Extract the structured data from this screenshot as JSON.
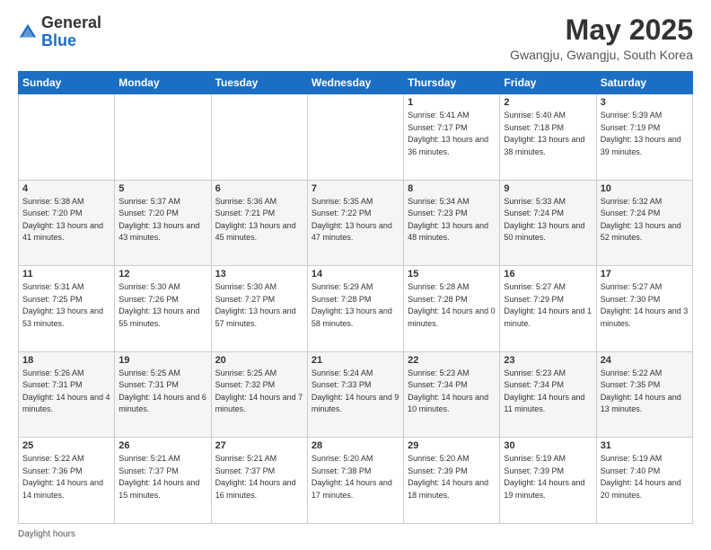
{
  "header": {
    "logo": {
      "general": "General",
      "blue": "Blue"
    },
    "title": "May 2025",
    "subtitle": "Gwangju, Gwangju, South Korea"
  },
  "calendar": {
    "days": [
      "Sunday",
      "Monday",
      "Tuesday",
      "Wednesday",
      "Thursday",
      "Friday",
      "Saturday"
    ],
    "weeks": [
      [
        {
          "day": "",
          "sunrise": "",
          "sunset": "",
          "daylight": ""
        },
        {
          "day": "",
          "sunrise": "",
          "sunset": "",
          "daylight": ""
        },
        {
          "day": "",
          "sunrise": "",
          "sunset": "",
          "daylight": ""
        },
        {
          "day": "",
          "sunrise": "",
          "sunset": "",
          "daylight": ""
        },
        {
          "day": "1",
          "sunrise": "Sunrise: 5:41 AM",
          "sunset": "Sunset: 7:17 PM",
          "daylight": "Daylight: 13 hours and 36 minutes."
        },
        {
          "day": "2",
          "sunrise": "Sunrise: 5:40 AM",
          "sunset": "Sunset: 7:18 PM",
          "daylight": "Daylight: 13 hours and 38 minutes."
        },
        {
          "day": "3",
          "sunrise": "Sunrise: 5:39 AM",
          "sunset": "Sunset: 7:19 PM",
          "daylight": "Daylight: 13 hours and 39 minutes."
        }
      ],
      [
        {
          "day": "4",
          "sunrise": "Sunrise: 5:38 AM",
          "sunset": "Sunset: 7:20 PM",
          "daylight": "Daylight: 13 hours and 41 minutes."
        },
        {
          "day": "5",
          "sunrise": "Sunrise: 5:37 AM",
          "sunset": "Sunset: 7:20 PM",
          "daylight": "Daylight: 13 hours and 43 minutes."
        },
        {
          "day": "6",
          "sunrise": "Sunrise: 5:36 AM",
          "sunset": "Sunset: 7:21 PM",
          "daylight": "Daylight: 13 hours and 45 minutes."
        },
        {
          "day": "7",
          "sunrise": "Sunrise: 5:35 AM",
          "sunset": "Sunset: 7:22 PM",
          "daylight": "Daylight: 13 hours and 47 minutes."
        },
        {
          "day": "8",
          "sunrise": "Sunrise: 5:34 AM",
          "sunset": "Sunset: 7:23 PM",
          "daylight": "Daylight: 13 hours and 48 minutes."
        },
        {
          "day": "9",
          "sunrise": "Sunrise: 5:33 AM",
          "sunset": "Sunset: 7:24 PM",
          "daylight": "Daylight: 13 hours and 50 minutes."
        },
        {
          "day": "10",
          "sunrise": "Sunrise: 5:32 AM",
          "sunset": "Sunset: 7:24 PM",
          "daylight": "Daylight: 13 hours and 52 minutes."
        }
      ],
      [
        {
          "day": "11",
          "sunrise": "Sunrise: 5:31 AM",
          "sunset": "Sunset: 7:25 PM",
          "daylight": "Daylight: 13 hours and 53 minutes."
        },
        {
          "day": "12",
          "sunrise": "Sunrise: 5:30 AM",
          "sunset": "Sunset: 7:26 PM",
          "daylight": "Daylight: 13 hours and 55 minutes."
        },
        {
          "day": "13",
          "sunrise": "Sunrise: 5:30 AM",
          "sunset": "Sunset: 7:27 PM",
          "daylight": "Daylight: 13 hours and 57 minutes."
        },
        {
          "day": "14",
          "sunrise": "Sunrise: 5:29 AM",
          "sunset": "Sunset: 7:28 PM",
          "daylight": "Daylight: 13 hours and 58 minutes."
        },
        {
          "day": "15",
          "sunrise": "Sunrise: 5:28 AM",
          "sunset": "Sunset: 7:28 PM",
          "daylight": "Daylight: 14 hours and 0 minutes."
        },
        {
          "day": "16",
          "sunrise": "Sunrise: 5:27 AM",
          "sunset": "Sunset: 7:29 PM",
          "daylight": "Daylight: 14 hours and 1 minute."
        },
        {
          "day": "17",
          "sunrise": "Sunrise: 5:27 AM",
          "sunset": "Sunset: 7:30 PM",
          "daylight": "Daylight: 14 hours and 3 minutes."
        }
      ],
      [
        {
          "day": "18",
          "sunrise": "Sunrise: 5:26 AM",
          "sunset": "Sunset: 7:31 PM",
          "daylight": "Daylight: 14 hours and 4 minutes."
        },
        {
          "day": "19",
          "sunrise": "Sunrise: 5:25 AM",
          "sunset": "Sunset: 7:31 PM",
          "daylight": "Daylight: 14 hours and 6 minutes."
        },
        {
          "day": "20",
          "sunrise": "Sunrise: 5:25 AM",
          "sunset": "Sunset: 7:32 PM",
          "daylight": "Daylight: 14 hours and 7 minutes."
        },
        {
          "day": "21",
          "sunrise": "Sunrise: 5:24 AM",
          "sunset": "Sunset: 7:33 PM",
          "daylight": "Daylight: 14 hours and 9 minutes."
        },
        {
          "day": "22",
          "sunrise": "Sunrise: 5:23 AM",
          "sunset": "Sunset: 7:34 PM",
          "daylight": "Daylight: 14 hours and 10 minutes."
        },
        {
          "day": "23",
          "sunrise": "Sunrise: 5:23 AM",
          "sunset": "Sunset: 7:34 PM",
          "daylight": "Daylight: 14 hours and 11 minutes."
        },
        {
          "day": "24",
          "sunrise": "Sunrise: 5:22 AM",
          "sunset": "Sunset: 7:35 PM",
          "daylight": "Daylight: 14 hours and 13 minutes."
        }
      ],
      [
        {
          "day": "25",
          "sunrise": "Sunrise: 5:22 AM",
          "sunset": "Sunset: 7:36 PM",
          "daylight": "Daylight: 14 hours and 14 minutes."
        },
        {
          "day": "26",
          "sunrise": "Sunrise: 5:21 AM",
          "sunset": "Sunset: 7:37 PM",
          "daylight": "Daylight: 14 hours and 15 minutes."
        },
        {
          "day": "27",
          "sunrise": "Sunrise: 5:21 AM",
          "sunset": "Sunset: 7:37 PM",
          "daylight": "Daylight: 14 hours and 16 minutes."
        },
        {
          "day": "28",
          "sunrise": "Sunrise: 5:20 AM",
          "sunset": "Sunset: 7:38 PM",
          "daylight": "Daylight: 14 hours and 17 minutes."
        },
        {
          "day": "29",
          "sunrise": "Sunrise: 5:20 AM",
          "sunset": "Sunset: 7:39 PM",
          "daylight": "Daylight: 14 hours and 18 minutes."
        },
        {
          "day": "30",
          "sunrise": "Sunrise: 5:19 AM",
          "sunset": "Sunset: 7:39 PM",
          "daylight": "Daylight: 14 hours and 19 minutes."
        },
        {
          "day": "31",
          "sunrise": "Sunrise: 5:19 AM",
          "sunset": "Sunset: 7:40 PM",
          "daylight": "Daylight: 14 hours and 20 minutes."
        }
      ]
    ]
  },
  "footer": {
    "note": "Daylight hours"
  }
}
